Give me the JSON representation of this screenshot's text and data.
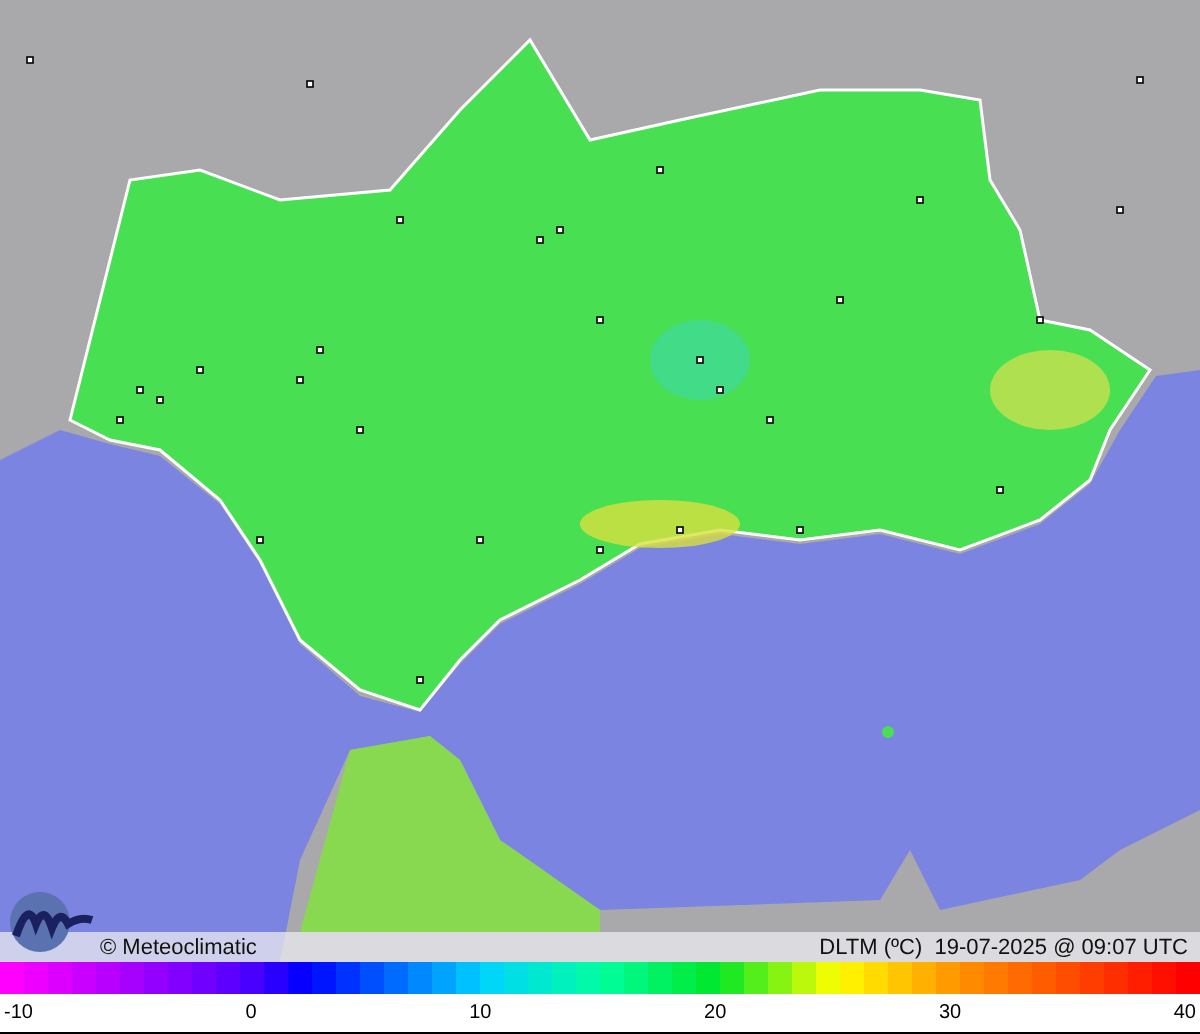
{
  "credit": "© Meteoclimatic",
  "caption": "DLTM (ºC)  19-07-2025 @ 09:07 UTC",
  "legend": {
    "ticks": [
      "-10",
      "0",
      "10",
      "20",
      "30",
      "40"
    ]
  }
}
